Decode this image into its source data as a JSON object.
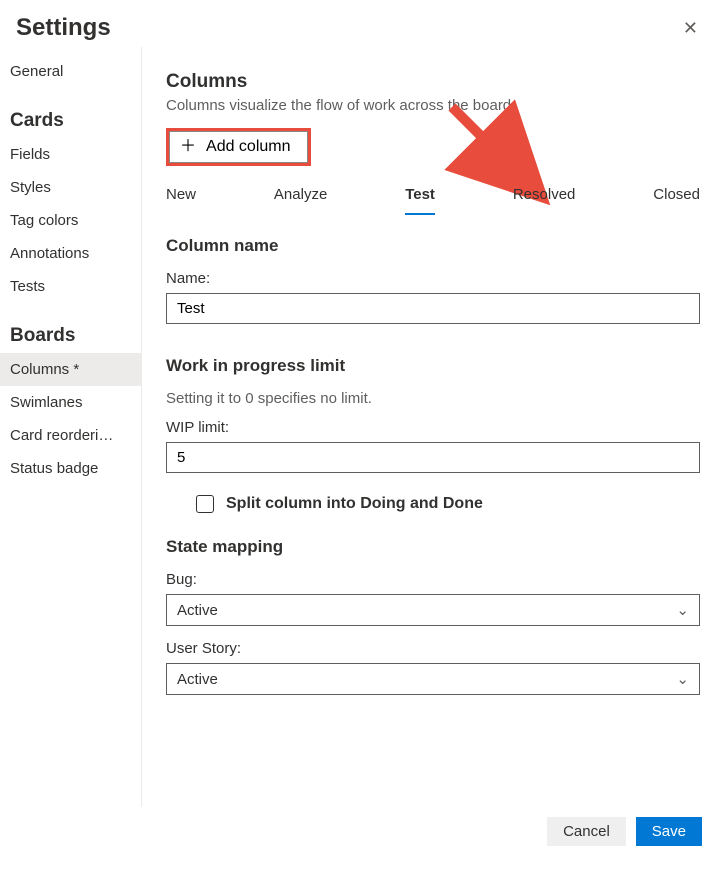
{
  "header": {
    "title": "Settings"
  },
  "sidebar": {
    "groups": [
      {
        "heading": null,
        "items": [
          "General"
        ]
      },
      {
        "heading": "Cards",
        "items": [
          "Fields",
          "Styles",
          "Tag colors",
          "Annotations",
          "Tests"
        ]
      },
      {
        "heading": "Boards",
        "items": [
          "Columns *",
          "Swimlanes",
          "Card reorderi…",
          "Status badge"
        ]
      }
    ],
    "active": "Columns *"
  },
  "main": {
    "columns_section": {
      "title": "Columns",
      "description": "Columns visualize the flow of work across the board."
    },
    "add_column_label": "Add column",
    "tabs": [
      "New",
      "Analyze",
      "Test",
      "Resolved",
      "Closed"
    ],
    "active_tab": "Test",
    "column_name": {
      "heading": "Column name",
      "name_label": "Name:",
      "name_value": "Test"
    },
    "wip": {
      "heading": "Work in progress limit",
      "hint": "Setting it to 0 specifies no limit.",
      "label": "WIP limit:",
      "value": "5"
    },
    "split_label": "Split column into Doing and Done",
    "state_mapping": {
      "heading": "State mapping",
      "bug_label": "Bug:",
      "bug_value": "Active",
      "story_label": "User Story:",
      "story_value": "Active"
    }
  },
  "footer": {
    "cancel": "Cancel",
    "save": "Save"
  }
}
